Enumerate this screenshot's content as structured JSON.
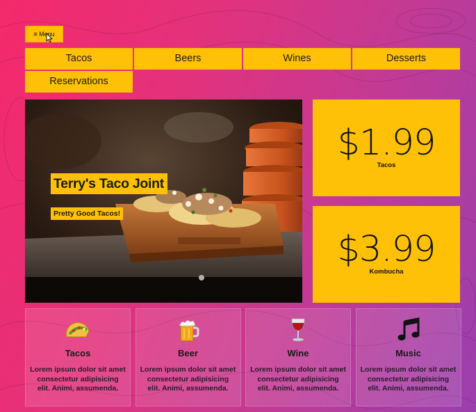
{
  "header": {
    "menu_label": "≡ Menu"
  },
  "nav": {
    "items": [
      {
        "label": "Tacos"
      },
      {
        "label": "Beers"
      },
      {
        "label": "Wines"
      },
      {
        "label": "Desserts"
      },
      {
        "label": "Reservations"
      }
    ]
  },
  "hero": {
    "title": "Terry's Taco Joint",
    "subtitle": "Pretty Good Tacos!",
    "image": "taco-plate-photo"
  },
  "prices": [
    {
      "amount": "$1.99",
      "item": "Tacos"
    },
    {
      "amount": "$3.99",
      "item": "Kombucha"
    }
  ],
  "features": [
    {
      "icon": "taco-icon",
      "title": "Tacos",
      "text": "Lorem ipsum dolor sit amet consectetur adipisicing elit. Animi, assumenda."
    },
    {
      "icon": "beer-mug-icon",
      "title": "Beer",
      "text": "Lorem ipsum dolor sit amet consectetur adipisicing elit. Animi, assumenda."
    },
    {
      "icon": "wine-glass-icon",
      "title": "Wine",
      "text": "Lorem ipsum dolor sit amet consectetur adipisicing elit. Animi, assumenda."
    },
    {
      "icon": "music-note-icon",
      "title": "Music",
      "text": "Lorem ipsum dolor sit amet consectetur adipisicing elit. Animi, assumenda."
    }
  ],
  "colors": {
    "accent": "#ffc107",
    "gradient_start": "#f4296b",
    "gradient_end": "#9a3fae"
  }
}
